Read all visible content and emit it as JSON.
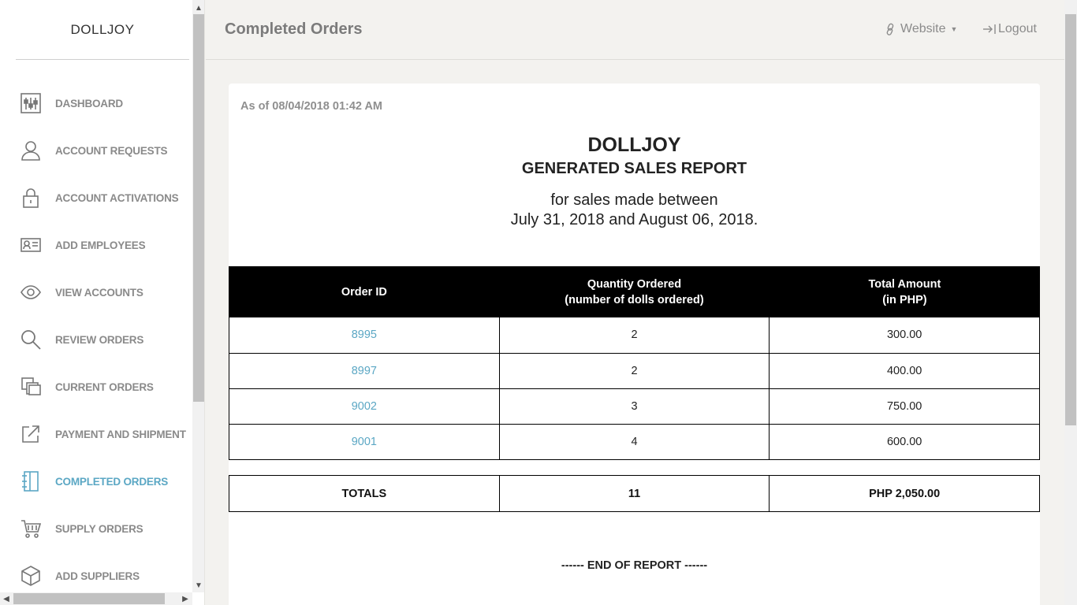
{
  "sidebar": {
    "brand": "DOLLJOY",
    "items": [
      {
        "label": "DASHBOARD",
        "icon": "dashboard-sliders-icon"
      },
      {
        "label": "ACCOUNT REQUESTS",
        "icon": "user-icon"
      },
      {
        "label": "ACCOUNT ACTIVATIONS",
        "icon": "lock-icon"
      },
      {
        "label": "ADD EMPLOYEES",
        "icon": "id-card-icon"
      },
      {
        "label": "VIEW ACCOUNTS",
        "icon": "eye-icon"
      },
      {
        "label": "REVIEW ORDERS",
        "icon": "search-icon"
      },
      {
        "label": "CURRENT ORDERS",
        "icon": "copy-icon"
      },
      {
        "label": "PAYMENT AND SHIPMENT",
        "icon": "external-link-icon"
      },
      {
        "label": "COMPLETED ORDERS",
        "icon": "notebook-icon"
      },
      {
        "label": "SUPPLY ORDERS",
        "icon": "cart-icon"
      },
      {
        "label": "ADD SUPPLIERS",
        "icon": "box-icon"
      }
    ],
    "active_item": "COMPLETED ORDERS"
  },
  "header": {
    "title": "Completed Orders",
    "website_label": "Website",
    "logout_label": "Logout"
  },
  "report": {
    "as_of": "As of 08/04/2018 01:42 AM",
    "brand": "DOLLJOY",
    "title": "GENERATED SALES REPORT",
    "subtitle_line1": "for sales made between",
    "subtitle_line2": "July 31, 2018 and August 06, 2018.",
    "columns": [
      {
        "line1": "Order ID",
        "line2": ""
      },
      {
        "line1": "Quantity Ordered",
        "line2": "(number of dolls ordered)"
      },
      {
        "line1": "Total Amount",
        "line2": "(in PHP)"
      }
    ],
    "rows": [
      {
        "order_id": "8995",
        "quantity": "2",
        "amount": "300.00"
      },
      {
        "order_id": "8997",
        "quantity": "2",
        "amount": "400.00"
      },
      {
        "order_id": "9002",
        "quantity": "3",
        "amount": "750.00"
      },
      {
        "order_id": "9001",
        "quantity": "4",
        "amount": "600.00"
      }
    ],
    "totals": {
      "label": "TOTALS",
      "quantity": "11",
      "amount": "PHP 2,050.00"
    },
    "end_text": "------ END OF REPORT ------"
  },
  "colors": {
    "accent": "#5ba7c4",
    "nav_text": "#8a8a8a",
    "table_header_bg": "#000000",
    "page_bg": "#f3f2ef"
  }
}
